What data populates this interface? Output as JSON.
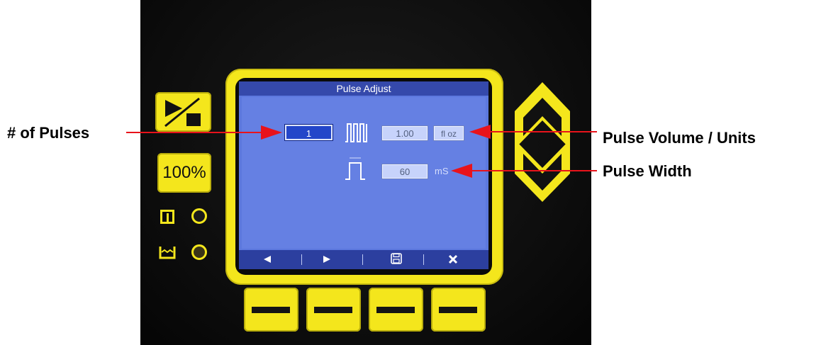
{
  "screen": {
    "title": "Pulse Adjust",
    "pulses_value": "1",
    "pulse_volume_value": "1.00",
    "pulse_volume_unit": "fl oz",
    "pulse_width_value": "60",
    "pulse_width_unit": "mS"
  },
  "navbar": {
    "left_icon": "left-triangle-icon",
    "right_icon": "right-triangle-icon",
    "save_icon": "floppy-disk-icon",
    "cancel_icon": "x-cancel-icon"
  },
  "device": {
    "speed_button_label": "100%",
    "accent_color": "#f4e61c",
    "screen_color": "#5c78de"
  },
  "callouts": {
    "pulses": "# of Pulses",
    "volume_units": "Pulse Volume / Units",
    "width": "Pulse Width"
  },
  "colors": {
    "arrow": "#e8131b"
  }
}
